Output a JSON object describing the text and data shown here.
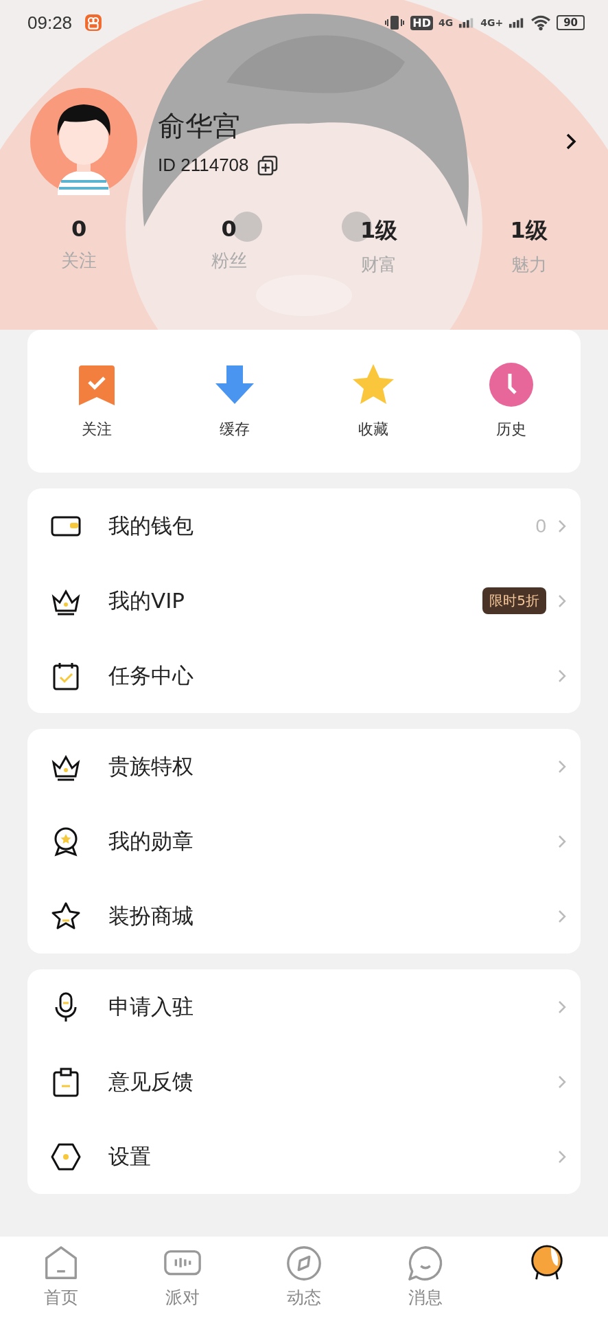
{
  "status_bar": {
    "time": "09:28",
    "hd": "HD",
    "network": [
      "4G",
      "4G+"
    ],
    "battery": "90"
  },
  "profile": {
    "name": "俞华宫",
    "id": "ID 2114708"
  },
  "stats": [
    {
      "value": "0",
      "label": "关注"
    },
    {
      "value": "0",
      "label": "粉丝"
    },
    {
      "value": "1级",
      "label": "财富"
    },
    {
      "value": "1级",
      "label": "魅力"
    }
  ],
  "shortcuts": [
    {
      "label": "关注"
    },
    {
      "label": "缓存"
    },
    {
      "label": "收藏"
    },
    {
      "label": "历史"
    }
  ],
  "menu_groups": [
    [
      {
        "label": "我的钱包",
        "value": "0"
      },
      {
        "label": "我的VIP",
        "badge": "限时5折"
      },
      {
        "label": "任务中心"
      }
    ],
    [
      {
        "label": "贵族特权"
      },
      {
        "label": "我的勋章"
      },
      {
        "label": "装扮商城"
      }
    ],
    [
      {
        "label": "申请入驻"
      },
      {
        "label": "意见反馈"
      },
      {
        "label": "设置"
      }
    ]
  ],
  "tab_bar": [
    {
      "label": "首页",
      "selected": false
    },
    {
      "label": "派对",
      "selected": false
    },
    {
      "label": "动态",
      "selected": false
    },
    {
      "label": "消息",
      "selected": false
    },
    {
      "selected": true
    }
  ]
}
